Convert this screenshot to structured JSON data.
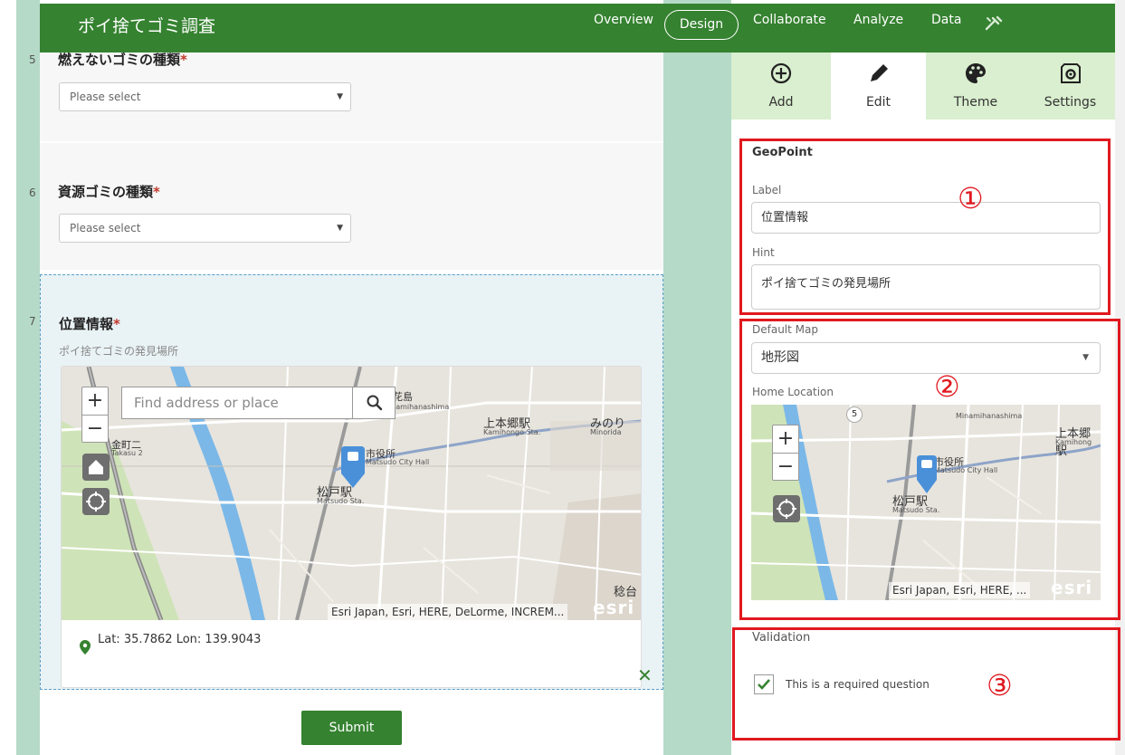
{
  "header": {
    "app_title": "ポイ捨てゴミ調査",
    "nav": [
      "Overview",
      "Design",
      "Collaborate",
      "Analyze",
      "Data"
    ],
    "active_nav": "Design"
  },
  "questions": [
    {
      "number": "5",
      "title": "燃えないゴミの種類",
      "required_mark": "*",
      "placeholder": "Please select"
    },
    {
      "number": "6",
      "title": "資源ゴミの種類",
      "required_mark": "*",
      "placeholder": "Please select"
    },
    {
      "number": "7",
      "title": "位置情報",
      "required_mark": "*",
      "hint": "ポイ捨てゴミの発見場所"
    }
  ],
  "geopoint_map": {
    "search_placeholder": "Find address or place",
    "zoom_in": "+",
    "zoom_out": "−",
    "labels": {
      "kamihongo": "上本郷駅",
      "kamihongo_en": "Kamihongo Sta.",
      "minori": "みのり",
      "minori_en": "Minorida",
      "matsudo": "松戸駅",
      "matsudo_en": "Matsudo Sta.",
      "cityhall": "市役所",
      "cityhall_en": "Matsudo City Hall",
      "nanaka": "南花島",
      "nanaka_en": "Minamihanashima",
      "kanamachi": "金町二",
      "kanamachi_en": "Takasu 2",
      "inaridai": "稔台"
    },
    "attribution": "Esri Japan, Esri, HERE, DeLorme, INCREM...",
    "esri": "esri",
    "coordinates": "Lat: 35.7862 Lon: 139.9043"
  },
  "submit_label": "Submit",
  "panel": {
    "tabs": [
      "Add",
      "Edit",
      "Theme",
      "Settings"
    ],
    "active_tab": "Edit",
    "section_title": "GeoPoint",
    "label_caption": "Label",
    "label_value": "位置情報",
    "hint_caption": "Hint",
    "hint_value": "ポイ捨てゴミの発見場所",
    "default_map_caption": "Default Map",
    "default_map_value": "地形図",
    "home_location_caption": "Home Location",
    "small_map_labels": {
      "kamihongo": "上本郷駅",
      "kamihongo_en": "Kamihong",
      "cityhall": "市役所",
      "cityhall_en": "Matsudo City Hall",
      "matsudo": "松戸駅",
      "matsudo_en": "Matsudo Sta.",
      "nanaka_en": "Minamihanashima",
      "route": "5"
    },
    "small_map_attribution": "Esri Japan, Esri, HERE, ...",
    "validation_caption": "Validation",
    "required_checkbox_label": "This is a required question",
    "required_checked": true
  },
  "annotations": [
    "①",
    "②",
    "③"
  ],
  "colors": {
    "brand_green": "#358230",
    "side_band": "#b5dac8",
    "tab_bg": "#d9efcf",
    "annotation_red": "#e0191f",
    "marker_blue": "#4a90d9"
  }
}
